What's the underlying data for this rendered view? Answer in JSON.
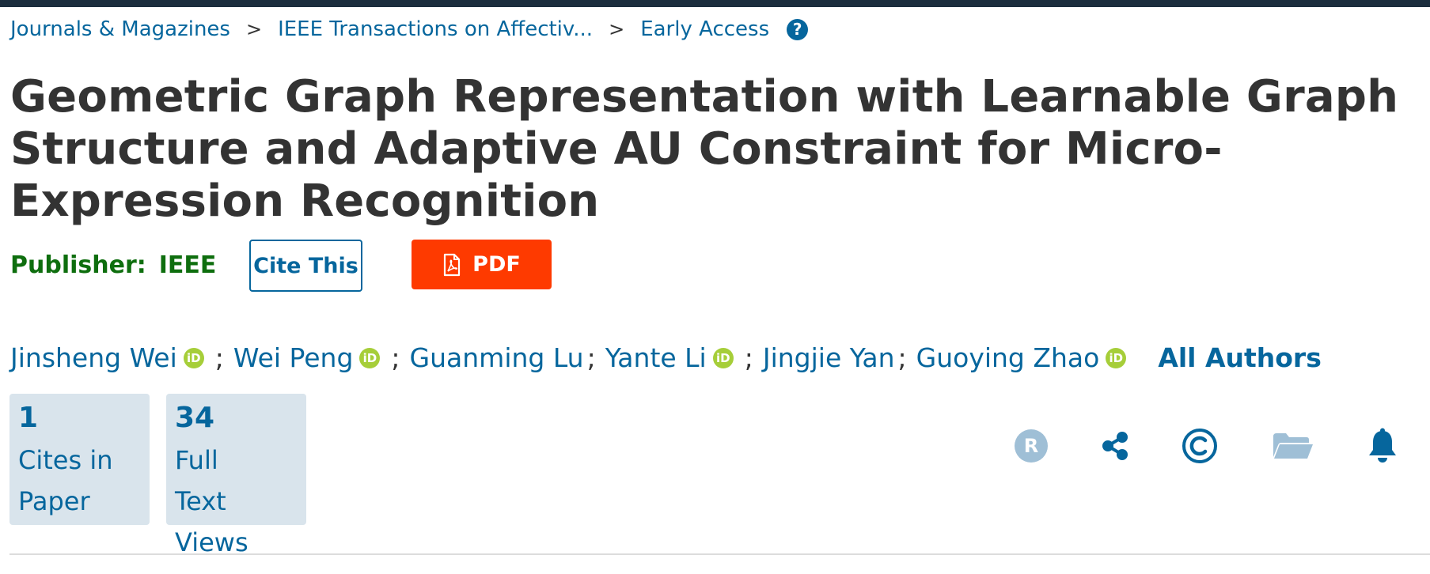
{
  "breadcrumb": {
    "items": [
      "Journals & Magazines",
      "IEEE Transactions on Affectiv...",
      "Early Access"
    ],
    "separator": ">",
    "help_glyph": "?"
  },
  "title": "Geometric Graph Representation with Learnable Graph Structure and Adaptive AU Constraint for Micro-Expression Recognition",
  "publisher": {
    "label": "Publisher:",
    "name": "IEEE"
  },
  "buttons": {
    "cite": "Cite This",
    "pdf": "PDF"
  },
  "authors": {
    "list": [
      {
        "name": "Jinsheng Wei",
        "orcid": true
      },
      {
        "name": "Wei Peng",
        "orcid": true
      },
      {
        "name": "Guanming Lu",
        "orcid": false
      },
      {
        "name": "Yante Li",
        "orcid": true
      },
      {
        "name": "Jingjie Yan",
        "orcid": false
      },
      {
        "name": "Guoying Zhao",
        "orcid": true
      }
    ],
    "separator": ";",
    "orcid_glyph": "iD",
    "all_authors": "All Authors"
  },
  "metrics": [
    {
      "value": "1",
      "label": "Cites in Paper"
    },
    {
      "value": "34",
      "label": "Full Text Views"
    }
  ],
  "action_icons": [
    "rights-permissions-icon",
    "share-icon",
    "copyright-icon",
    "folder-icon",
    "alert-bell-icon"
  ],
  "colors": {
    "link": "#06669d",
    "publisher": "#0e6e0e",
    "pdf_button": "#fe3a00",
    "metric_bg": "#d9e4ec",
    "orcid": "#a6ce39",
    "top_bar": "#1c2e3e"
  }
}
